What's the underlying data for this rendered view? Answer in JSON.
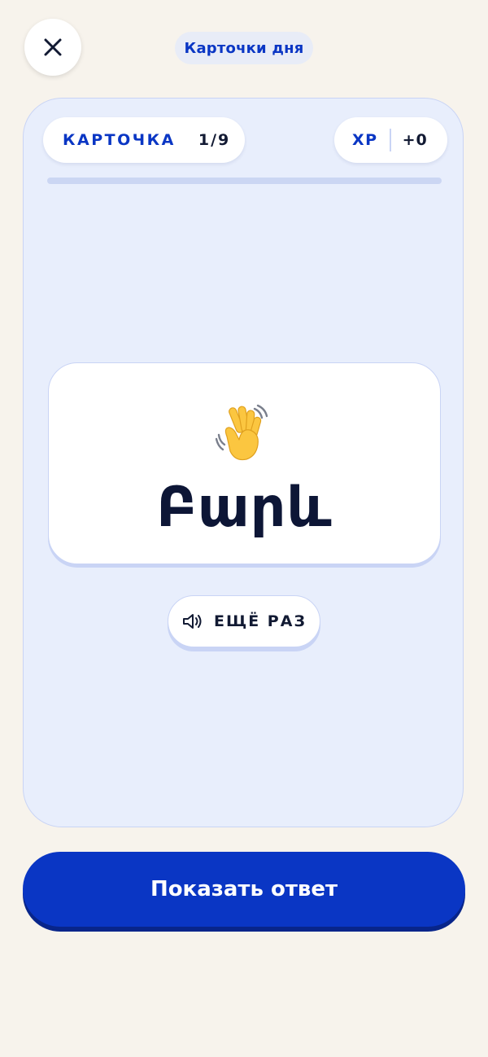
{
  "header": {
    "title": "Карточки дня",
    "close_icon": "close-icon"
  },
  "stats": {
    "card_label": "КАРТОЧКА",
    "card_progress": "1/9",
    "xp_label": "XP",
    "xp_value": "+0",
    "progress_fraction": 0
  },
  "card": {
    "emoji_icon": "waving-hand-icon",
    "word": "Բարև"
  },
  "replay": {
    "icon": "speaker-icon",
    "label": "ЕЩЁ РАЗ"
  },
  "actions": {
    "show_answer_label": "Показать ответ"
  },
  "colors": {
    "background": "#f7f3ec",
    "accent": "#0a36c4",
    "panel": "#e8eefc",
    "panel_border": "#c9d4f5",
    "text_dark": "#121a33",
    "hand_yellow": "#fbc640"
  }
}
